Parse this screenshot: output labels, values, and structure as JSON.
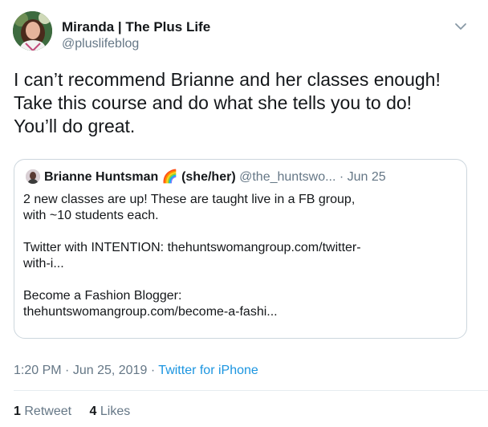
{
  "author": {
    "name": "Miranda | The Plus Life",
    "handle": "@pluslifeblog"
  },
  "tweet_text": [
    "I can’t recommend Brianne and her classes enough!",
    "Take this course and do what she tells you to do!",
    "You’ll do great."
  ],
  "quoted": {
    "name": "Brianne Huntsman",
    "emoji": "🌈",
    "pronouns": "(she/her)",
    "handle": "@the_huntswo...",
    "separator": "·",
    "date": "Jun 25",
    "lines": [
      "2 new classes are up!  These are taught live in a FB group,",
      "with ~10 students each.",
      "",
      "Twitter with INTENTION: thehuntswomangroup.com/twitter-",
      "with-i...",
      "",
      "Become a Fashion Blogger:",
      "thehuntswomangroup.com/become-a-fashi..."
    ]
  },
  "meta": {
    "time": "1:20 PM",
    "date": "Jun 25, 2019",
    "separator": "·",
    "source": "Twitter for iPhone"
  },
  "stats": {
    "retweets_count": "1",
    "retweets_label": "Retweet",
    "likes_count": "4",
    "likes_label": "Likes"
  },
  "colors": {
    "text": "#14171a",
    "secondary": "#657786",
    "link": "#1b95e0",
    "border": "#ccd6dd"
  },
  "icons": {
    "caret": "chevron-down-icon",
    "avatar": "profile-photo",
    "quoted_avatar": "profile-photo-small"
  }
}
